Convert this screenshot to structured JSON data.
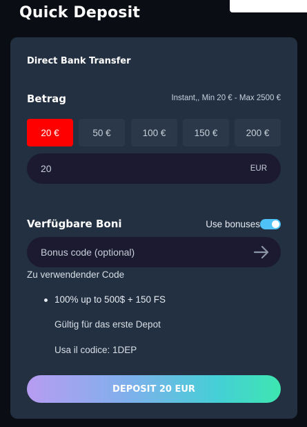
{
  "header": {
    "title": "Quick Deposit"
  },
  "payment_method": {
    "title": "Direct Bank Transfer"
  },
  "amount": {
    "label": "Betrag",
    "limits": "Instant,, Min 20 € - Max 2500 €",
    "presets": [
      {
        "label": "20 €",
        "selected": true
      },
      {
        "label": "50 €",
        "selected": false
      },
      {
        "label": "100 €",
        "selected": false
      },
      {
        "label": "150 €",
        "selected": false
      },
      {
        "label": "200 €",
        "selected": false
      }
    ],
    "value": "20",
    "currency": "EUR"
  },
  "bonus": {
    "label": "Verfügbare Boni",
    "toggle_label": "Use bonuses",
    "toggle_on": true,
    "code_placeholder": "Bonus code (optional)",
    "code_hint": "Zu verwendender Code",
    "offer": "100% up to 500$ + 150 FS",
    "valid_for": "Gültig für das erste Depot",
    "code_text": "Usa il codice: 1DEP",
    "arrow_icon": "arrow-right-icon"
  },
  "submit": {
    "label": "DEPOSIT 20 EUR"
  },
  "colors": {
    "panel": "#233041",
    "active_chip": "#ff0000",
    "toggle": "#4fc3f7",
    "input_bg": "#1b1a30"
  }
}
